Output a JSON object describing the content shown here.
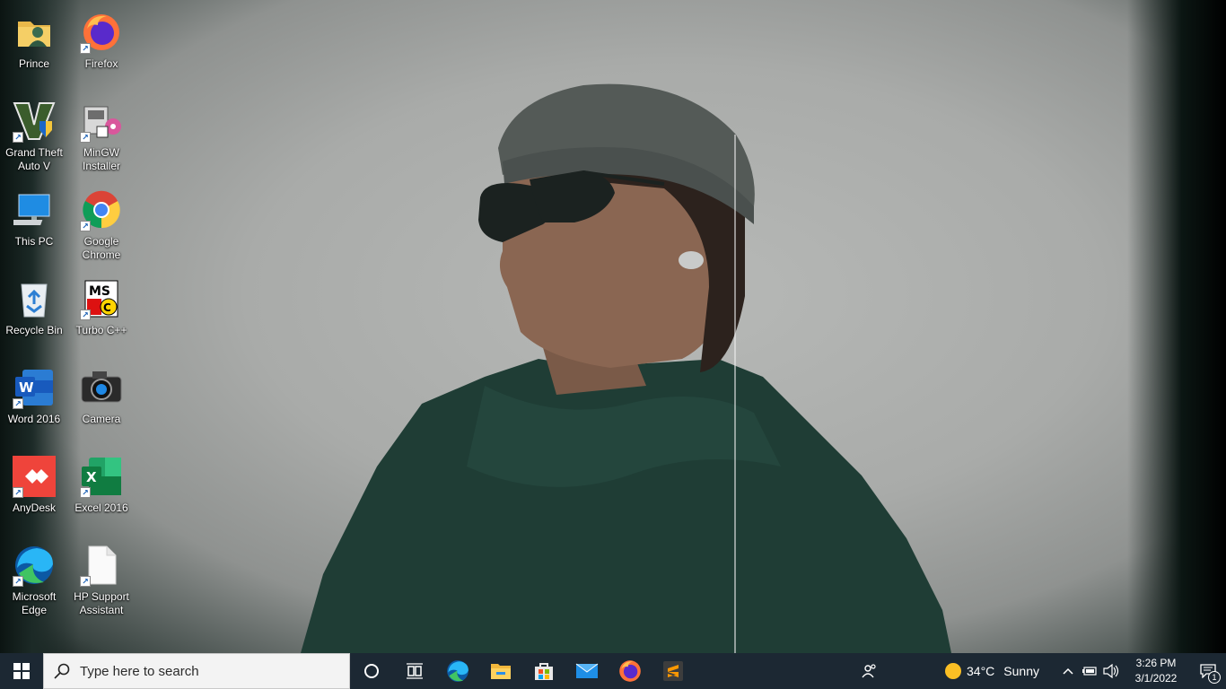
{
  "desktop": {
    "icons": [
      {
        "label": "Prince",
        "icon": "user-folder-icon"
      },
      {
        "label": "Firefox",
        "icon": "firefox-icon"
      },
      {
        "label": "Grand Theft Auto V",
        "icon": "gta-v-icon"
      },
      {
        "label": "MinGW Installer",
        "icon": "mingw-installer-icon"
      },
      {
        "label": "This PC",
        "icon": "computer-icon"
      },
      {
        "label": "Google Chrome",
        "icon": "chrome-icon"
      },
      {
        "label": "Recycle Bin",
        "icon": "recycle-bin-icon"
      },
      {
        "label": "Turbo C++",
        "icon": "turbo-cpp-icon"
      },
      {
        "label": "Word 2016",
        "icon": "word-icon"
      },
      {
        "label": "Camera",
        "icon": "camera-icon"
      },
      {
        "label": "AnyDesk",
        "icon": "anydesk-icon"
      },
      {
        "label": "Excel 2016",
        "icon": "excel-icon"
      },
      {
        "label": "Microsoft Edge",
        "icon": "edge-icon"
      },
      {
        "label": "HP Support Assistant",
        "icon": "document-icon"
      }
    ]
  },
  "taskbar": {
    "search_placeholder": "Type here to search",
    "pinned": [
      "cortana-icon",
      "task-view-icon",
      "edge-icon",
      "file-explorer-icon",
      "microsoft-store-icon",
      "mail-icon",
      "firefox-icon",
      "sublime-text-icon"
    ],
    "weather": {
      "temperature": "34°C",
      "condition": "Sunny"
    },
    "clock": {
      "time": "3:26 PM",
      "date": "3/1/2022"
    },
    "notification_count": "1"
  },
  "colors": {
    "taskbar": "#1c2833",
    "accent": "#0078d4"
  }
}
